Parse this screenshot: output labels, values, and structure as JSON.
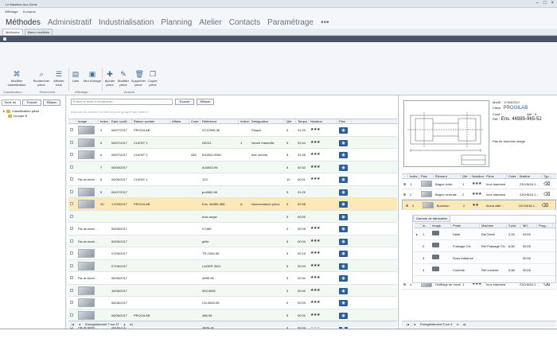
{
  "window": {
    "title": "Le Machine Aux Devis",
    "controls": [
      "–",
      "□",
      "×"
    ]
  },
  "menu": [
    "Affichage",
    "À propos"
  ],
  "modules": [
    "Méthodes",
    "Administratif",
    "Industrialisation",
    "Planning",
    "Atelier",
    "Contacts",
    "Paramétrage",
    "•••"
  ],
  "subtabs": [
    "Méthodes",
    "Macro modèles"
  ],
  "ribbon": {
    "buttons": [
      {
        "icon": "share-icon",
        "glyph": "⌘",
        "label1": "Modifier",
        "label2": "classification"
      },
      {
        "icon": "search-icon",
        "glyph": "⌕",
        "label1": "Rechercher",
        "label2": "pièce"
      },
      {
        "icon": "list-icon",
        "glyph": "☰",
        "label1": "Afficher",
        "label2": "tous"
      },
      {
        "icon": "list-view-icon",
        "glyph": "▤",
        "label1": "Liste",
        "label2": ""
      },
      {
        "icon": "image-view-icon",
        "glyph": "▣",
        "label1": "Mur d'image",
        "label2": ""
      },
      {
        "icon": "add-icon",
        "glyph": "✚",
        "label1": "Ajouter",
        "label2": "pièce"
      },
      {
        "icon": "edit-icon",
        "glyph": "✎",
        "label1": "Modifier",
        "label2": "pièce"
      },
      {
        "icon": "trash-icon",
        "glyph": "🗑",
        "label1": "Supprimer",
        "label2": "pièce"
      },
      {
        "icon": "copy-icon",
        "glyph": "❐",
        "label1": "Copier",
        "label2": "pièce"
      }
    ],
    "groups": [
      "Classification",
      "Recherche",
      "Affichage",
      "Actions"
    ]
  },
  "left": {
    "filter_value": "Toute de",
    "search_btn": "Trouver",
    "clear_btn": "Effacer",
    "tree": [
      "Classification pièce",
      "Groupe B"
    ]
  },
  "center": {
    "search_placeholder": "Entrez le texte à rechercher...",
    "search_btn": "Trouver",
    "clear_btn": "Effacer",
    "group_hint": "Déposer la colonne en-tête ici pour grouper par celle-ci",
    "columns": [
      "",
      "Image",
      "Index",
      "Date modif...",
      "Raison sociale",
      "Affaire",
      "Code",
      "Référence",
      "Indice",
      "Désignation",
      "Qté",
      "Temps t...",
      "Notation",
      "Plan"
    ],
    "rows": [
      {
        "image": "img",
        "index": "4",
        "date": "06/07/2017",
        "client": "PROGILAB",
        "affaire": "",
        "code": "",
        "ref": "ZC12596-96",
        "indice": "",
        "desig": "Plaque",
        "qte": "5",
        "temps": "01:20",
        "stars": "★★★",
        "plan": true
      },
      {
        "image": "img",
        "index": "5",
        "date": "05/07/2017",
        "client": "CLIENT 1",
        "affaire": "",
        "code": "",
        "ref": "NZ211",
        "indice": "1",
        "desig": "Vanne manuelle",
        "qte": "5",
        "temps": "03:44",
        "stars": "★★★",
        "plan": true
      },
      {
        "image": "img",
        "index": "6",
        "date": "05/07/2017",
        "client": "CLIENT 2",
        "affaire": "",
        "code": "284",
        "ref": "B41562-956C",
        "indice": "",
        "desig": "Axe central",
        "qte": "5",
        "temps": "02:46",
        "stars": "★★★",
        "plan": true
      },
      {
        "image": "none",
        "index": "7",
        "date": "06/06/2017",
        "client": "",
        "affaire": "",
        "code": "",
        "ref": "A44563-96",
        "indice": "",
        "desig": "",
        "qte": "5",
        "temps": "02:52",
        "stars": "★★★",
        "plan": true
      },
      {
        "image": "Pas de donné...",
        "index": "8",
        "date": "05/06/2017",
        "client": "CLIENT 1",
        "affaire": "",
        "code": "",
        "ref": "123",
        "indice": "",
        "desig": "",
        "qte": "10",
        "temps": "00:01",
        "stars": "★★★",
        "plan": true
      },
      {
        "image": "img",
        "index": "9",
        "date": "05/07/2017",
        "client": "",
        "affaire": "",
        "code": "",
        "ref": "po4563-96",
        "indice": "",
        "desig": "",
        "qte": "5",
        "temps": "01:20",
        "stars": "",
        "plan": true
      },
      {
        "image": "img",
        "index": "10",
        "date": "17/03/2017",
        "client": "PROGILAB",
        "affaire": "",
        "code": "",
        "ref": "Ens. 46985-965...",
        "indice": "A",
        "desig": "Nomenclature pièce",
        "qte": "5",
        "temps": "02:58",
        "stars": "",
        "plan": true,
        "selected": true
      },
      {
        "image": "none",
        "index": "",
        "date": "",
        "client": "",
        "affaire": "",
        "code": "",
        "ref": "brac-segw",
        "indice": "",
        "desig": "",
        "qte": "5",
        "temps": "00:00",
        "stars": "",
        "plan": true
      },
      {
        "image": "Pas de donné...",
        "index": "",
        "date": "06/06/2017",
        "client": "",
        "affaire": "",
        "code": "",
        "ref": "K7485",
        "indice": "",
        "desig": "",
        "qte": "5",
        "temps": "00:05",
        "stars": "★★★",
        "plan": true
      },
      {
        "image": "Pas de donné...",
        "index": "",
        "date": "06/06/2017",
        "client": "",
        "affaire": "",
        "code": "",
        "ref": "grille",
        "indice": "",
        "desig": "",
        "qte": "5",
        "temps": "00:00",
        "stars": "★★★",
        "plan": true
      },
      {
        "image": "img",
        "index": "",
        "date": "07/06/2017",
        "client": "",
        "affaire": "",
        "code": "",
        "ref": "TR-1526-96",
        "indice": "",
        "desig": "",
        "qte": "5",
        "temps": "00:18",
        "stars": "★★★",
        "plan": true
      },
      {
        "image": "img",
        "index": "",
        "date": "07/06/2017",
        "client": "",
        "affaire": "",
        "code": "",
        "ref": "LAGER 3001",
        "indice": "",
        "desig": "",
        "qte": "5",
        "temps": "00:00",
        "stars": "★★★",
        "plan": true
      },
      {
        "image": "Pas de donné...",
        "index": "",
        "date": "06/06/2017",
        "client": "",
        "affaire": "",
        "code": "",
        "ref": "4896-96",
        "indice": "",
        "desig": "",
        "qte": "5",
        "temps": "00:30",
        "stars": "★★★",
        "plan": true
      },
      {
        "image": "img",
        "index": "",
        "date": "16/06/2017",
        "client": "",
        "affaire": "",
        "code": "",
        "ref": "963-9852",
        "indice": "",
        "desig": "",
        "qte": "5",
        "temps": "00:00",
        "stars": "★★★",
        "plan": true
      },
      {
        "image": "img",
        "index": "",
        "date": "06/06/2017",
        "client": "",
        "affaire": "",
        "code": "",
        "ref": "CN.4963-96",
        "indice": "",
        "desig": "",
        "qte": "5",
        "temps": "00:00",
        "stars": "★★★",
        "plan": true
      },
      {
        "image": "img",
        "index": "",
        "date": "06/06/2017",
        "client": "PROGILAB",
        "affaire": "",
        "code": "",
        "ref": "486-96",
        "indice": "",
        "desig": "",
        "qte": "5",
        "temps": "00:00",
        "stars": "★★★",
        "plan": true
      },
      {
        "image": "Pas de donné...",
        "index": "",
        "date": "06/06/2017",
        "client": "",
        "affaire": "",
        "code": "",
        "ref": "4896-36",
        "indice": "",
        "desig": "",
        "qte": "5",
        "temps": "00:00",
        "stars": "★★★",
        "plan": true
      }
    ],
    "footer": "Enregistrement 7 sur 37"
  },
  "right": {
    "modif_label": "Modif. :",
    "modif_value": "17/03/2017",
    "client_label": "Client :",
    "client_value": "PROGILAB",
    "code_label": "Code :",
    "qte_label": "Qté :",
    "qte_value": "5",
    "ref_label": "Réf. :",
    "ref_value": "Ens. 46985-965-52",
    "no_image": "Pas de données image",
    "subcolumns": [
      "",
      "Index",
      "Plan",
      "Élément",
      "Qté",
      "Notation",
      "Pièce",
      "Code",
      "Matière",
      "Typ..."
    ],
    "subrows": [
      {
        "index": "1",
        "elem": "Bague exter...",
        "qte": "1",
        "stars": "★★★",
        "piece": "Inox standard",
        "matiere": "23CrNi18-1..."
      },
      {
        "index": "2",
        "elem": "Bague centrale",
        "qte": "2",
        "stars": "★★★",
        "piece": "Inox standard",
        "matiere": "23CrNi18-1..."
      },
      {
        "index": "3",
        "elem": "Bouchon",
        "qte": "2",
        "stars": "★★",
        "piece": "Acera allié...",
        "matiere": "22CrNi18-1...",
        "selected": true
      },
      {
        "index": "4",
        "elem": "Outillage de montage",
        "qte": "1",
        "stars": "★★★",
        "piece": "Inox standard",
        "matiere": "23CrNi18-1..."
      }
    ],
    "fab_tab": "Gamme de fabrication",
    "fabcolumns": [
      "",
      "In...",
      "Image",
      "Poste",
      "Machine",
      "Code",
      "MO",
      "Prog..."
    ],
    "fabrows": [
      {
        "idx": "1",
        "poste": "Débit",
        "machine": "Ref Débit",
        "code": "3,53",
        "mo": "03:00"
      },
      {
        "idx": "2",
        "poste": "Fraisage CN",
        "machine": "Ref Fraisage CN",
        "code": "8,80",
        "mo": "05:00"
      },
      {
        "idx": "3",
        "poste": "Sous-traitance",
        "machine": "",
        "code": "",
        "mo": "00:00"
      },
      {
        "idx": "4",
        "poste": "Contrôle",
        "machine": "Ref contrôle",
        "code": "5,88",
        "mo": "00:00"
      }
    ],
    "footer": "Enregistrement 3 sur 4"
  }
}
